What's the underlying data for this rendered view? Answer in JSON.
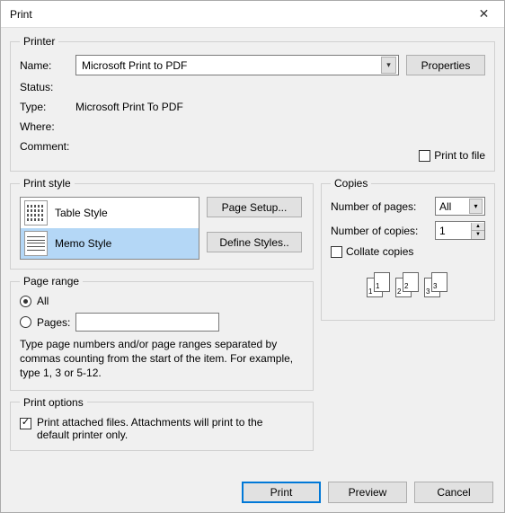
{
  "window": {
    "title": "Print"
  },
  "printer": {
    "legend": "Printer",
    "name_label": "Name:",
    "name_value": "Microsoft Print to PDF",
    "properties_label": "Properties",
    "status_label": "Status:",
    "status_value": "",
    "type_label": "Type:",
    "type_value": "Microsoft Print To PDF",
    "where_label": "Where:",
    "where_value": "",
    "comment_label": "Comment:",
    "comment_value": "",
    "print_to_file_label": "Print to file",
    "print_to_file_checked": false
  },
  "print_style": {
    "legend": "Print style",
    "items": [
      {
        "label": "Table Style",
        "selected": false
      },
      {
        "label": "Memo Style",
        "selected": true
      }
    ],
    "page_setup_label": "Page Setup...",
    "define_styles_label": "Define Styles.."
  },
  "copies": {
    "legend": "Copies",
    "num_pages_label": "Number of pages:",
    "num_pages_value": "All",
    "num_copies_label": "Number of copies:",
    "num_copies_value": "1",
    "collate_label": "Collate copies",
    "collate_checked": false,
    "illus": [
      "1",
      "1",
      "2",
      "2",
      "3",
      "3"
    ]
  },
  "page_range": {
    "legend": "Page range",
    "all_label": "All",
    "all_selected": true,
    "pages_label": "Pages:",
    "pages_selected": false,
    "pages_value": "",
    "help": "Type page numbers and/or page ranges separated by commas counting from the start of the item.  For example, type 1, 3 or 5-12."
  },
  "print_options": {
    "legend": "Print options",
    "attach_label": "Print attached files.  Attachments will print to the default printer only.",
    "attach_checked": true
  },
  "footer": {
    "print": "Print",
    "preview": "Preview",
    "cancel": "Cancel"
  }
}
